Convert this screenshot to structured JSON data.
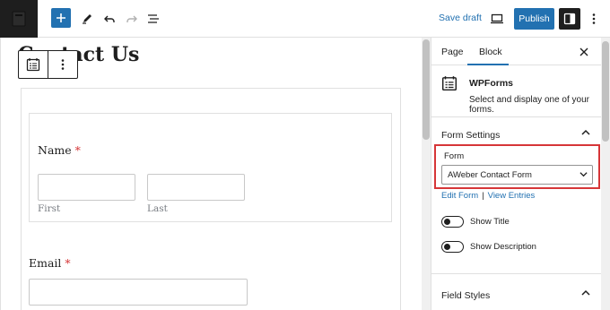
{
  "toolbar": {
    "save_draft": "Save draft",
    "publish": "Publish",
    "icons": [
      "wordpress-logo",
      "plus",
      "pencil",
      "undo",
      "redo",
      "list-view",
      "preview-desktop",
      "settings-sidebar",
      "more-vertical"
    ]
  },
  "editor": {
    "page_title": "Contact Us",
    "form": {
      "name_label": "Name",
      "required_mark": "*",
      "first_sublabel": "First",
      "last_sublabel": "Last",
      "email_label": "Email"
    }
  },
  "sidebar": {
    "tabs": [
      {
        "label": "Page",
        "active": false
      },
      {
        "label": "Block",
        "active": true
      }
    ],
    "block_card": {
      "title": "WPForms",
      "description": "Select and display one of your forms."
    },
    "form_settings": {
      "title": "Form Settings",
      "form_label": "Form",
      "selected_form": "AWeber Contact Form",
      "edit_form": "Edit Form",
      "separator": "|",
      "view_entries": "View Entries",
      "show_title": "Show Title",
      "show_description": "Show Description"
    },
    "field_styles": {
      "title": "Field Styles"
    }
  },
  "colors": {
    "accent": "#2271b1",
    "highlight_border": "#d63638",
    "dark": "#1e1e1e"
  }
}
